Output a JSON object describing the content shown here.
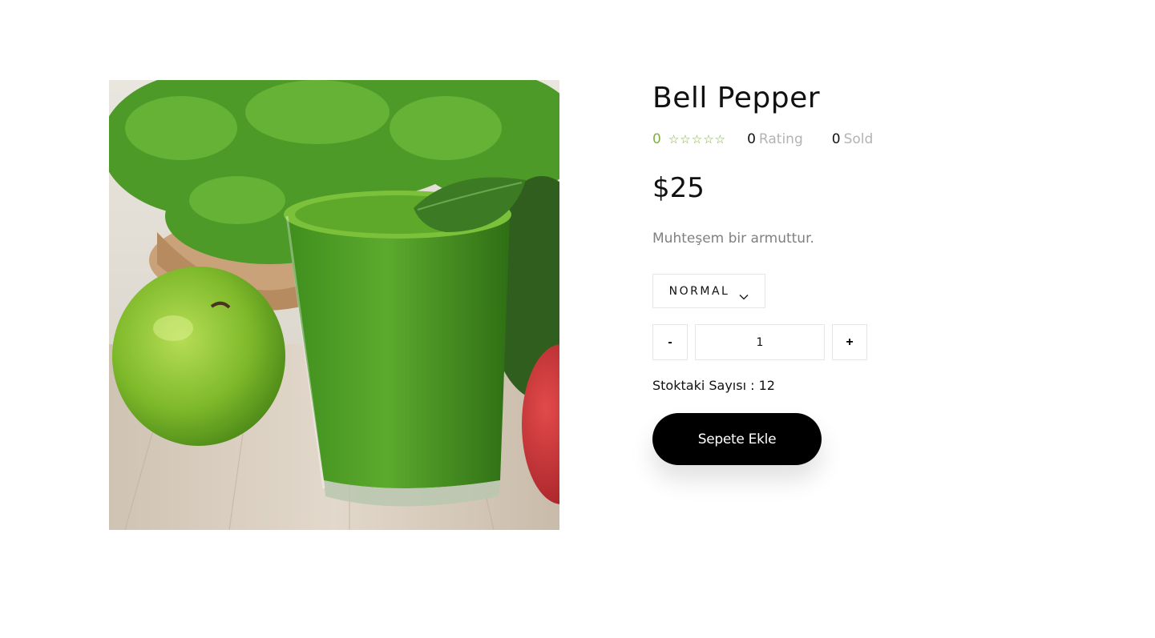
{
  "product": {
    "title": "Bell Pepper",
    "image_alt": "green-smoothie-product-image",
    "rating": {
      "score": "0",
      "stars_filled": 0,
      "stars_total": 5,
      "rating_count": "0",
      "rating_label": "Rating",
      "sold_count": "0",
      "sold_label": "Sold"
    },
    "price": "$25",
    "description": "Muhteşem bir armuttur.",
    "variant": {
      "selected": "NORMAL"
    },
    "quantity": {
      "minus_label": "-",
      "value": "1",
      "plus_label": "+"
    },
    "stock_text": "Stoktaki Sayısı : 12",
    "add_to_cart_label": "Sepete Ekle"
  },
  "colors": {
    "accent": "#82ae46",
    "text": "#111111",
    "muted": "#808080",
    "button": "#000000"
  }
}
